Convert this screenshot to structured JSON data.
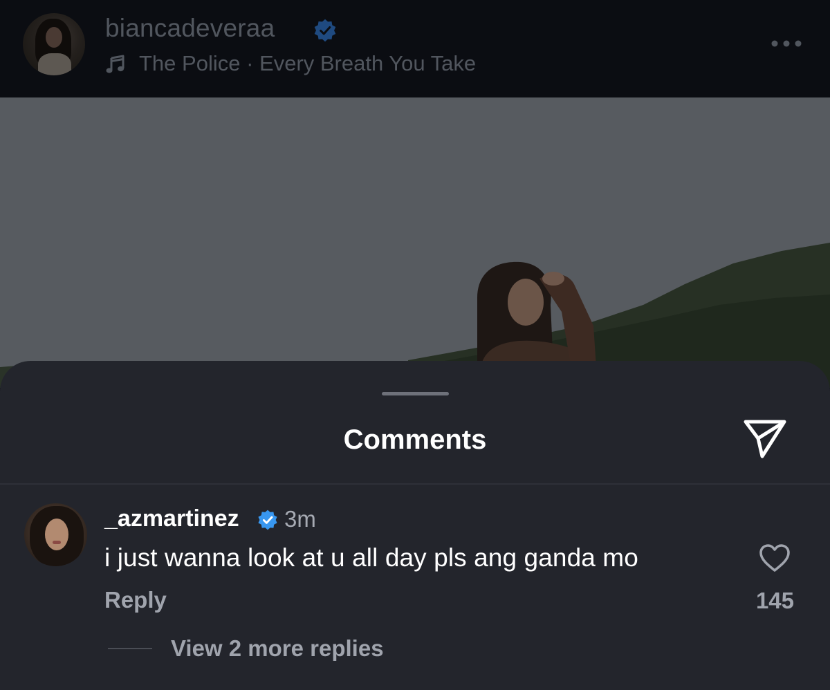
{
  "header": {
    "username": "biancadeveraa",
    "verified_icon": "verified-badge-icon",
    "music_icon": "music-note-icon",
    "song": "The Police · Every Breath You Take",
    "more_icon": "more-options-icon"
  },
  "sheet": {
    "title": "Comments",
    "share_icon": "send-icon"
  },
  "comments": [
    {
      "username": "_azmartinez",
      "verified": true,
      "time": "3m",
      "text": "i just wanna look at u all day pls ang ganda mo",
      "reply_label": "Reply",
      "like_count": "145",
      "view_replies_label": "View 2 more replies"
    }
  ],
  "colors": {
    "verified_blue": "#3897f0",
    "sheet_bg": "#23252c",
    "muted_text": "#a0a4ad"
  }
}
